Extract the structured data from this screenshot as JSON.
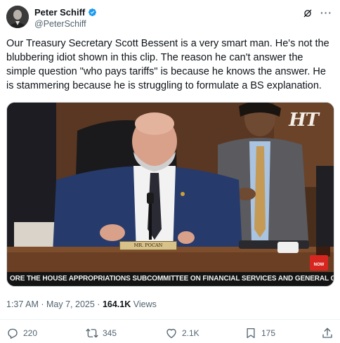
{
  "author": {
    "name": "Peter Schiff",
    "handle": "@PeterSchiff",
    "avatar_icon": "user-photo",
    "verified": true
  },
  "tweet": {
    "text": "Our Treasury Secretary Scott Bessent is a very smart man. He's not the blubbering idiot shown in this clip. The reason he can't answer the simple question \"who pays tariffs\" is because he knows the answer. He is stammering because he is struggling to formulate a BS explanation."
  },
  "media": {
    "logo": "HT",
    "nameplate": "MR. POCAN",
    "ticker": "ORE THE HOUSE APPROPRIATIONS SUBCOMMITTEE ON FINANCIAL SERVICES AND GENERAL GOVERN",
    "badge": "NOW"
  },
  "meta": {
    "time": "1:37 AM",
    "separator": "·",
    "date": "May 7, 2025",
    "views_count": "164.1K",
    "views_label": "Views"
  },
  "actions": {
    "replies": "220",
    "retweets": "345",
    "likes": "2.1K",
    "bookmarks": "175"
  },
  "colors": {
    "text": "#0f1419",
    "secondary": "#536471",
    "verified": "#1d9bf0",
    "divider": "#eff3f4"
  }
}
